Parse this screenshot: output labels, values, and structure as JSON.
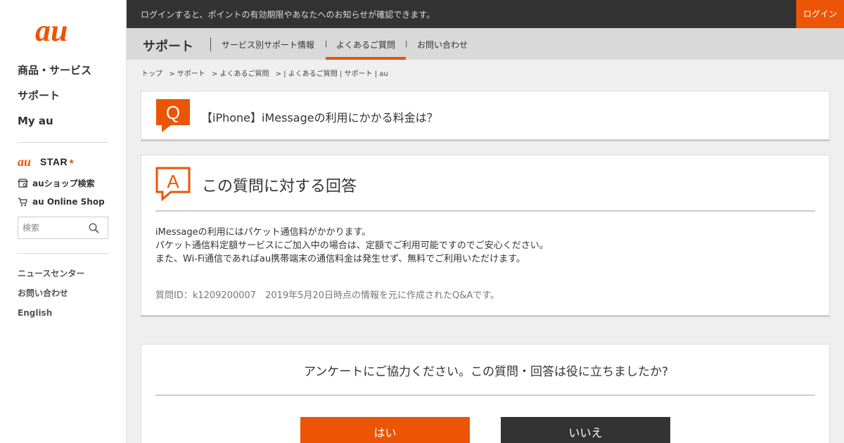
{
  "brand": {
    "accent": "#eb5505",
    "dark": "#333333"
  },
  "sidebar": {
    "logo_text": "au",
    "nav": [
      {
        "label": "商品・サービス"
      },
      {
        "label": "サポート"
      },
      {
        "label": "My au"
      }
    ],
    "austar_label": "STAR",
    "shop_search": "auショップ検索",
    "online_shop": "au Online Shop",
    "search_placeholder": "検索",
    "links": [
      {
        "label": "ニュースセンター"
      },
      {
        "label": "お問い合わせ"
      },
      {
        "label": "English"
      }
    ]
  },
  "topbar": {
    "notice": "ログインすると、ポイントの有効期限やあなたへのお知らせが確認できます。",
    "login": "ログイン"
  },
  "subnav": {
    "title": "サポート",
    "items": [
      {
        "label": "サービス別サポート情報"
      },
      {
        "label": "よくあるご質問"
      },
      {
        "label": "お問い合わせ"
      }
    ],
    "separator": "|"
  },
  "breadcrumb": [
    "トップ",
    "> サポート",
    "> よくあるご質問",
    "> | よくあるご質問 | サポート | au"
  ],
  "question": {
    "icon_letter": "Q",
    "title": "【iPhone】iMessageの利用にかかる料金は？"
  },
  "answer": {
    "icon_letter": "A",
    "heading": "この質問に対する回答",
    "lines": [
      "iMessageの利用にはパケット通信料がかかります。",
      "パケット通信料定額サービスにご加入中の場合は、定額でご利用可能ですのでご安心ください。",
      "また、Wi-Fi通信であればau携帯端末の通信料金は発生せず、無料でご利用いただけます。"
    ],
    "meta": "質問ID：k1209200007　2019年5月20日時点の情報を元に作成されたQ&Aです。"
  },
  "survey": {
    "question": "アンケートにご協力ください。この質問・回答は役に立ちましたか?",
    "yes": "はい",
    "no": "いいえ"
  }
}
